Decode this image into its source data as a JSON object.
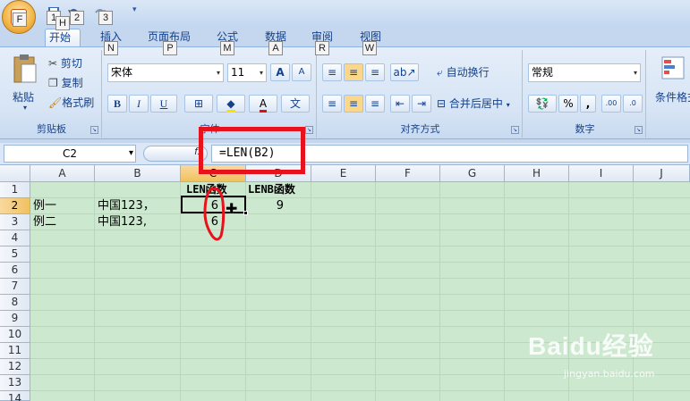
{
  "titlebar": {
    "keytips": [
      "F",
      "1",
      "2",
      "3"
    ]
  },
  "tabs": [
    {
      "label": "开始",
      "keytip": "H"
    },
    {
      "label": "插入",
      "keytip": "N"
    },
    {
      "label": "页面布局",
      "keytip": "P"
    },
    {
      "label": "公式",
      "keytip": "M"
    },
    {
      "label": "数据",
      "keytip": "A"
    },
    {
      "label": "审阅",
      "keytip": "R"
    },
    {
      "label": "视图",
      "keytip": "W"
    }
  ],
  "ribbon": {
    "clipboard": {
      "label": "剪贴板",
      "paste": "粘贴",
      "cut": "剪切",
      "copy": "复制",
      "format_painter": "格式刷"
    },
    "font": {
      "label": "字体",
      "font_name": "宋体",
      "font_size": "11",
      "bold": "B",
      "italic": "I",
      "underline": "U",
      "grow": "A",
      "shrink": "A",
      "color_a": "A",
      "phonetic": "文"
    },
    "alignment": {
      "label": "对齐方式",
      "wrap": "自动换行",
      "merge": "合并后居中"
    },
    "number": {
      "label": "数字",
      "format": "常规",
      "percent": "%",
      "comma": ","
    },
    "styles": {
      "conditional": "条件格式"
    }
  },
  "formula_bar": {
    "name_box": "C2",
    "fx": "fx",
    "formula": "=LEN(B2)"
  },
  "columns": [
    "A",
    "B",
    "C",
    "D",
    "E",
    "F",
    "G",
    "H",
    "I",
    "J"
  ],
  "rows": [
    "1",
    "2",
    "3",
    "4",
    "5",
    "6",
    "7",
    "8",
    "9",
    "10",
    "11",
    "12",
    "13",
    "14"
  ],
  "cells": {
    "C1": "LEN函数",
    "D1": "LENB函数",
    "A2": "例一",
    "B2": "中国123，",
    "C2": "6",
    "D2": "9",
    "A3": "例二",
    "B3": "中国123,",
    "C3": "6"
  },
  "watermark": {
    "brand": "Baidu经验",
    "url": "jingyan.baidu.com"
  },
  "colors": {
    "grid_bg": "#cce8cf",
    "annotation_red": "#e8121c",
    "selected_header": "#f1c15f"
  }
}
